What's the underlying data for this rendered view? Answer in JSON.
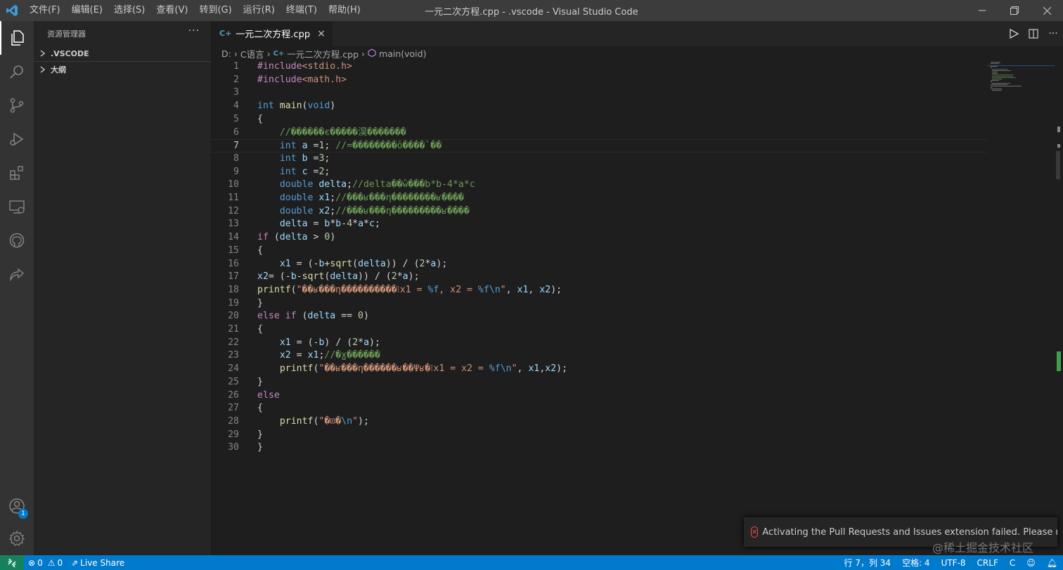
{
  "window": {
    "title": "一元二次方程.cpp - .vscode - Visual Studio Code",
    "menu": [
      "文件(F)",
      "编辑(E)",
      "选择(S)",
      "查看(V)",
      "转到(G)",
      "运行(R)",
      "终端(T)",
      "帮助(H)"
    ]
  },
  "activity": {
    "account_badge": "1"
  },
  "sidebar": {
    "title": "资源管理器",
    "more": "···",
    "sections": [
      ".VSCODE",
      "大纲"
    ]
  },
  "tab": {
    "icon_text": "C+",
    "label": "一元二次方程.cpp",
    "close": "×"
  },
  "breadcrumbs": {
    "items": [
      "D:",
      "C语言",
      "一元二次方程.cpp",
      "main(void)"
    ],
    "file_icon_text": "C+"
  },
  "editor": {
    "current_line": 7,
    "lines": [
      {
        "n": "1",
        "text": "#include<stdio.h>"
      },
      {
        "n": "2",
        "text": "#include<math.h>"
      },
      {
        "n": "3",
        "text": ""
      },
      {
        "n": "4",
        "text": "int main(void)"
      },
      {
        "n": "5",
        "text": "{"
      },
      {
        "n": "6",
        "text": "    //������є�����淏�������"
      },
      {
        "n": "7",
        "text": "    int a =1; //=��������ŏ����`��"
      },
      {
        "n": "8",
        "text": "    int b =3;"
      },
      {
        "n": "9",
        "text": "    int c =2;"
      },
      {
        "n": "10",
        "text": "    double delta;//delta��ŵ���b*b-4*a*c"
      },
      {
        "n": "11",
        "text": "    double x1;//���ʁ���η��������ʁ����"
      },
      {
        "n": "12",
        "text": "    double x2;//���ʁ���η���������ʁ����"
      },
      {
        "n": "13",
        "text": "    delta = b*b-4*a*c;"
      },
      {
        "n": "14",
        "text": "if (delta > 0)"
      },
      {
        "n": "15",
        "text": "{"
      },
      {
        "n": "16",
        "text": "    x1 = (-b+sqrt(delta)) / (2*a);"
      },
      {
        "n": "17",
        "text": "x2= (-b-sqrt(delta)) / (2*a);"
      },
      {
        "n": "18",
        "text": "printf(\"��ʁ���η����������⁝x1 = %f, x2 = %f\\n\", x1, x2);"
      },
      {
        "n": "19",
        "text": "}"
      },
      {
        "n": "20",
        "text": "else if (delta == 0)"
      },
      {
        "n": "21",
        "text": "{"
      },
      {
        "n": "22",
        "text": "    x1 = (-b) / (2*a);"
      },
      {
        "n": "23",
        "text": "    x2 = x1;//�ɣ������"
      },
      {
        "n": "24",
        "text": "    printf(\"��ʁ���η������ʁ��Ψʁ�⁝x1 = x2 = %f\\n\", x1,x2);"
      },
      {
        "n": "25",
        "text": "}"
      },
      {
        "n": "26",
        "text": "else"
      },
      {
        "n": "27",
        "text": "{"
      },
      {
        "n": "28",
        "text": "    printf(\"�⊡�\\n\");"
      },
      {
        "n": "29",
        "text": "}"
      },
      {
        "n": "30",
        "text": "}"
      }
    ]
  },
  "notification": {
    "text": "Activating the Pull Requests and Issues extension failed. Please make s..."
  },
  "watermark": "@稀土掘金技术社区",
  "statusbar": {
    "errors": "0",
    "warnings": "0",
    "live_share": "Live Share",
    "position": "行 7，列 34",
    "spaces": "空格: 4",
    "encoding": "UTF-8",
    "eol": "CRLF",
    "language": "C"
  },
  "colors": {
    "accent": "#007acc",
    "keyword": "#569cd6",
    "control": "#c586c0",
    "function": "#dcdcaa",
    "string": "#ce9178",
    "number": "#b5cea8",
    "comment": "#6a9955"
  }
}
